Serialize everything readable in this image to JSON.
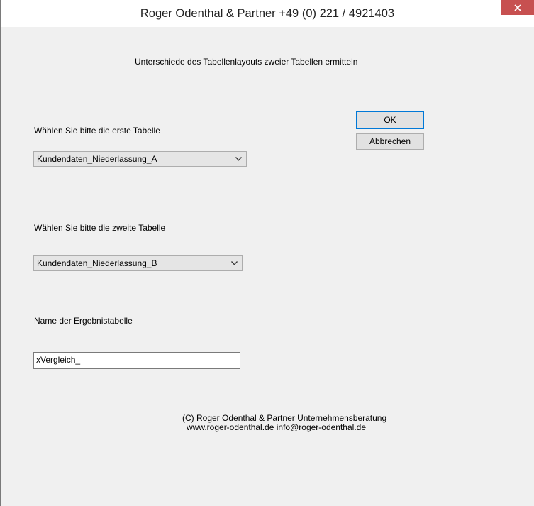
{
  "window": {
    "title": "Roger Odenthal & Partner    +49 (0) 221 / 4921403",
    "close_symbol": "✕"
  },
  "dialog": {
    "heading": "Unterschiede des Tabellenlayouts zweier Tabellen ermitteln",
    "first_table_label": "Wählen Sie bitte die erste Tabelle",
    "first_table_value": "Kundendaten_Niederlassung_A",
    "second_table_label": "Wählen Sie bitte die zweite Tabelle",
    "second_table_value": "Kundendaten_Niederlassung_B",
    "result_label": "Name der Ergebnistabelle",
    "result_value": "xVergleich_",
    "ok_label": "OK",
    "cancel_label": "Abbrechen",
    "footer_line1": "(C) Roger Odenthal & Partner Unternehmensberatung",
    "footer_line2": "www.roger-odenthal.de   info@roger-odenthal.de"
  }
}
